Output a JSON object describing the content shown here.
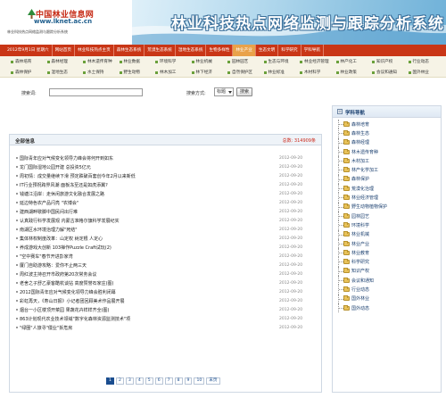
{
  "header": {
    "logo_cn": "中国林业信息网",
    "logo_url": "www.lknet.ac.cn",
    "tagline": "林业科技热点网络监测与跟踪分析系统",
    "banner_title": "林业科技热点网络监测与跟踪分析系统"
  },
  "nav_primary": [
    {
      "label": "2012年9月1日  星期六",
      "type": "date"
    },
    {
      "label": "网站首页",
      "type": "normal"
    },
    {
      "label": "林业科技热点主页",
      "type": "normal"
    },
    {
      "label": "森林生态系统",
      "type": "normal"
    },
    {
      "label": "荒漠生态系统",
      "type": "normal"
    },
    {
      "label": "湿地生态系统",
      "type": "normal"
    },
    {
      "label": "生物多样性",
      "type": "normal"
    },
    {
      "label": "林业产业",
      "type": "alt"
    },
    {
      "label": "生态文明",
      "type": "normal"
    },
    {
      "label": "科学研究",
      "type": "normal"
    },
    {
      "label": "学科导航",
      "type": "normal"
    }
  ],
  "nav_secondary": {
    "row1": [
      "森林培育",
      "森林经理",
      "林木遗传育种",
      "林业数据",
      "环境科学",
      "林业机械",
      "园林园艺",
      "生态与环境",
      "林业经济管理",
      "林产化工",
      "知识产权",
      "行业动态"
    ],
    "row2": [
      "森林保护",
      "湿地生态",
      "水土保持",
      "野生动物",
      "林木加工",
      "林下经济",
      "自然保护区",
      "林业标准",
      "木材科学",
      "林业政策",
      "会议和通知",
      "国外林业"
    ]
  },
  "search": {
    "keyword_label": "搜索词:",
    "keyword_value": "",
    "mode_label": "搜索方式:",
    "mode_value": "标题",
    "button_label": "搜索"
  },
  "main": {
    "title": "全部信息",
    "total": "总数: 314909条",
    "items": [
      {
        "title": "国际青年应对气候变化领导力峰会将何开到如东",
        "date": "2012-09-20"
      },
      {
        "title": "龙门国际湿地公园开建  总投资5亿元",
        "date": "2012-09-20"
      },
      {
        "title": "周初情：成交量继续下滑  预定跌破百套创今年2月以来新低",
        "date": "2012-09-20"
      },
      {
        "title": "IT行业预祝跨界风潮  面板冻至还是如虎添翼?",
        "date": "2012-09-20"
      },
      {
        "title": "钱塘江沿岸：走休闲旅游文化融合发展之路",
        "date": "2012-09-20"
      },
      {
        "title": "延边特色农产品闪亮 \"农博会\"",
        "date": "2012-09-20"
      },
      {
        "title": "建西湖畔歇脚中国民间出行难",
        "date": "2012-09-20"
      },
      {
        "title": "认真践行科学发展观  内蒙古准格尔旗科学发展纪实",
        "date": "2012-09-20"
      },
      {
        "title": "南湖区水环境治理力解\"死结\"",
        "date": "2012-09-20"
      },
      {
        "title": "集体林权制度改革：山定权  树定根  人定心",
        "date": "2012-09-20"
      },
      {
        "title": "养成游戏大创新  103禅作Puzzle Craft试玩(2)",
        "date": "2012-09-20"
      },
      {
        "title": "\"空中赛车\"春节开进彭家湾",
        "date": "2012-09-20"
      },
      {
        "title": "厦门自助游攻略：爱你不止两三天",
        "date": "2012-09-20"
      },
      {
        "title": "周红波主持召开市政府第20次常务会议",
        "date": "2012-09-20"
      },
      {
        "title": "老舍之子舒乙豪客酷杭谈拈  高度赞誉石家庄(图)",
        "date": "2012-09-20"
      },
      {
        "title": "2012国际青年应对气候变化领导力峰会胜利闭幕",
        "date": "2012-09-20"
      },
      {
        "title": "彩虹再天，《寿山日报》小记者团回顾美术作品展开展",
        "date": "2012-09-20"
      },
      {
        "title": "烟台一小区楼顶开菜园  果蔬花卉样样齐全(图)",
        "date": "2012-09-20"
      },
      {
        "title": "863计划现代农业技术领域\"数字化森林资源监测技术\"项",
        "date": "2012-09-20"
      },
      {
        "title": "\"绿圈\"人旅寻\"僵业\"拆危房",
        "date": "2012-09-20"
      }
    ],
    "pager": [
      "1",
      "2",
      "3",
      "4",
      "5",
      "6",
      "7",
      "8",
      "9",
      "10",
      "末页"
    ]
  },
  "sidebar": {
    "title": "学科导航",
    "items": [
      "森林培育",
      "森林生态",
      "森林经理",
      "林木遗传育种",
      "木材加工",
      "林产化学加工",
      "森林保护",
      "荒漠化治理",
      "林业经济管理",
      "野生动物植物保护",
      "园林园艺",
      "环境科学",
      "林业机械",
      "林业产业",
      "林业教育",
      "科学研究",
      "知识产权",
      "会议和通知",
      "行业动态",
      "国外林业",
      "国外动态"
    ]
  },
  "colors": {
    "nav_red": "#c93616",
    "nav_alt": "#e9a24a",
    "link_blue": "#1a4d8f",
    "total_red": "#cc2b1d"
  }
}
